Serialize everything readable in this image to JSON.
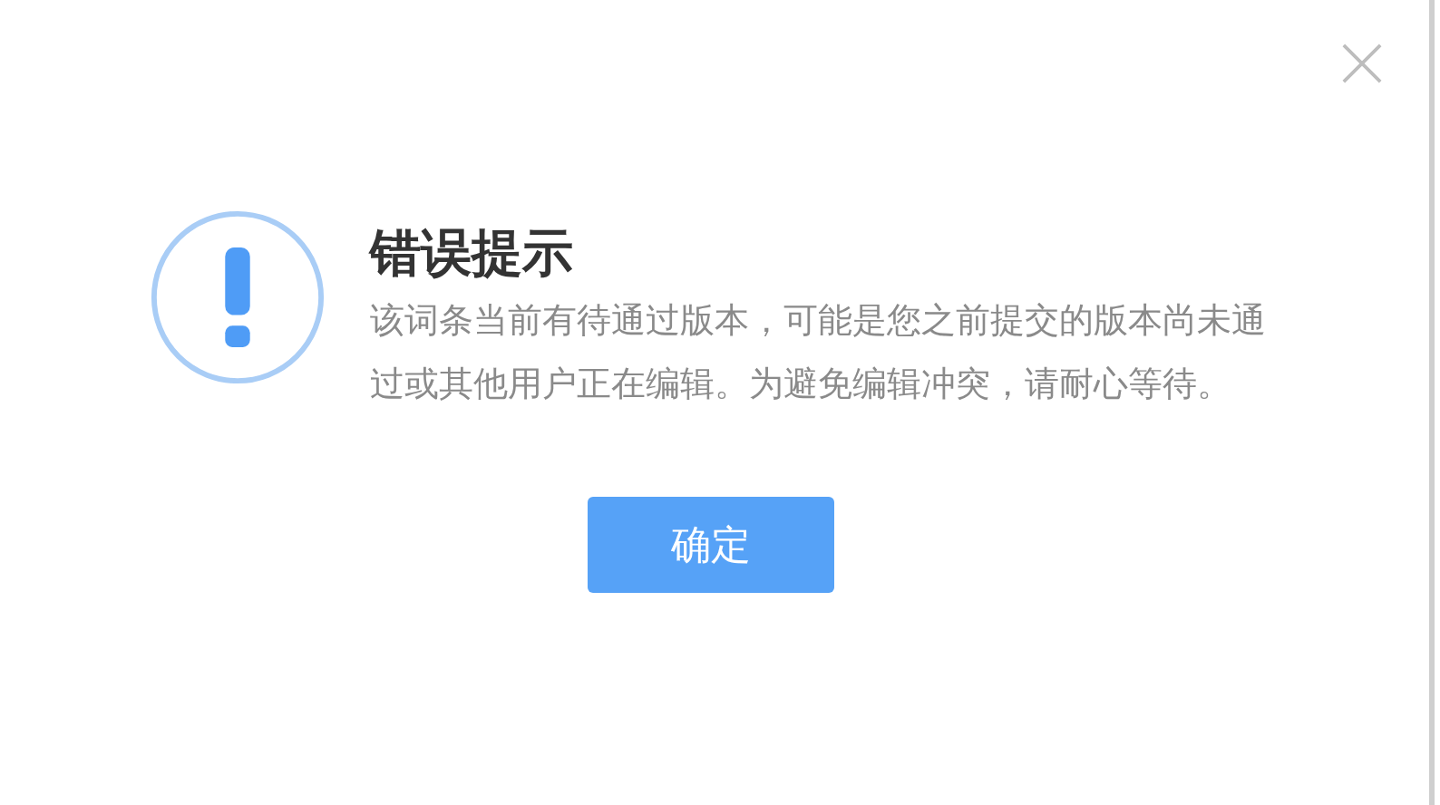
{
  "dialog": {
    "title": "错误提示",
    "message": "该词条当前有待通过版本，可能是您之前提交的版本尚未通过或其他用户正在编辑。为避免编辑冲突，请耐心等待。",
    "buttons": [
      {
        "label": "确定",
        "kind": "primary"
      }
    ]
  }
}
